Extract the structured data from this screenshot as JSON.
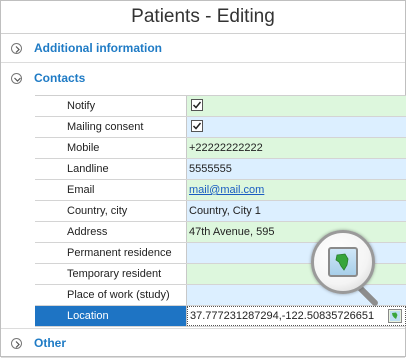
{
  "window": {
    "title": "Patients - Editing"
  },
  "groups": {
    "additional": "Additional information",
    "contacts": "Contacts",
    "other": "Other"
  },
  "fields": [
    {
      "label": "Notify",
      "value": "",
      "checked": true
    },
    {
      "label": "Mailing consent",
      "value": "",
      "checked": true
    },
    {
      "label": "Mobile",
      "value": "+22222222222"
    },
    {
      "label": "Landline",
      "value": "5555555"
    },
    {
      "label": "Email",
      "value": "mail@mail.com"
    },
    {
      "label": "Country, city",
      "value": "Country, City 1"
    },
    {
      "label": "Address",
      "value": "47th Avenue, 595"
    },
    {
      "label": "Permanent residence",
      "value": ""
    },
    {
      "label": "Temporary resident",
      "value": ""
    },
    {
      "label": "Place of work (study)",
      "value": ""
    },
    {
      "label": "Location",
      "value": "37.777231287294,-122.50835726651"
    }
  ],
  "icons": {
    "expand": "chevron-right-icon",
    "collapse": "chevron-down-icon",
    "map": "map-icon"
  },
  "colors": {
    "accent": "#1f7bc5",
    "selected": "#1e74c4",
    "green": "#ddf7dd",
    "blue": "#dcefff"
  }
}
